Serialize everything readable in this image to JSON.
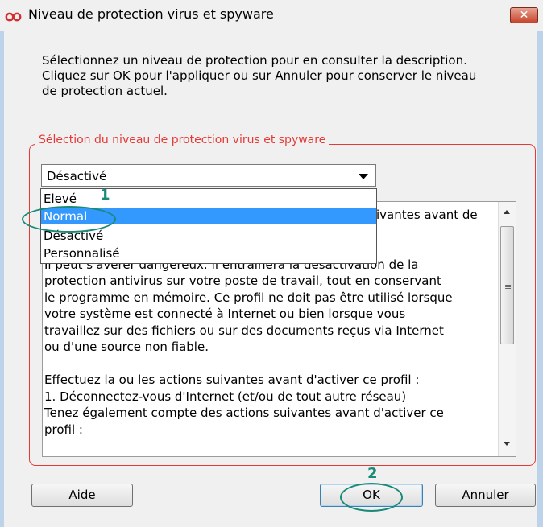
{
  "window": {
    "title": "Niveau de protection virus et spyware",
    "close_label": "✕",
    "icon": "app-logo-icon"
  },
  "description": {
    "lines": [
      "Sélectionnez un niveau de protection pour en consulter la description.",
      "Cliquez sur OK pour l'appliquer ou sur Annuler pour conserver le niveau",
      "de protection actuel."
    ]
  },
  "group": {
    "legend": "Sélection du niveau de protection virus et spyware"
  },
  "level_select": {
    "selected": "Désactivé",
    "options": [
      "Elevé",
      "Normal",
      "Désactivé",
      "Personnalisé"
    ],
    "highlighted": "Normal"
  },
  "details": {
    "partial_first": "ivantes avant de",
    "lines": [
      "Il peut s'avérer dangereux. Il entraînera la désactivation de la",
      "protection antivirus sur votre poste de travail, tout en conservant",
      "le programme en mémoire. Ce profil ne doit pas être utilisé lorsque",
      "votre système est connecté à Internet ou bien lorsque vous",
      "travaillez sur des fichiers ou sur des documents reçus via Internet",
      "ou d'une source non fiable.",
      "",
      "Effectuez la ou les actions suivantes avant d'activer ce profil :",
      "1. Déconnectez-vous d'Internet (et/ou de tout autre réseau)",
      "Tenez également compte des actions suivantes avant d'activer ce",
      "profil :"
    ]
  },
  "buttons": {
    "help": "Aide",
    "ok": "OK",
    "cancel": "Annuler"
  },
  "annotations": {
    "step1": "1",
    "step2": "2",
    "color": "#1a8a78"
  },
  "colors": {
    "group_border": "#e53935",
    "selection": "#3399ff"
  }
}
